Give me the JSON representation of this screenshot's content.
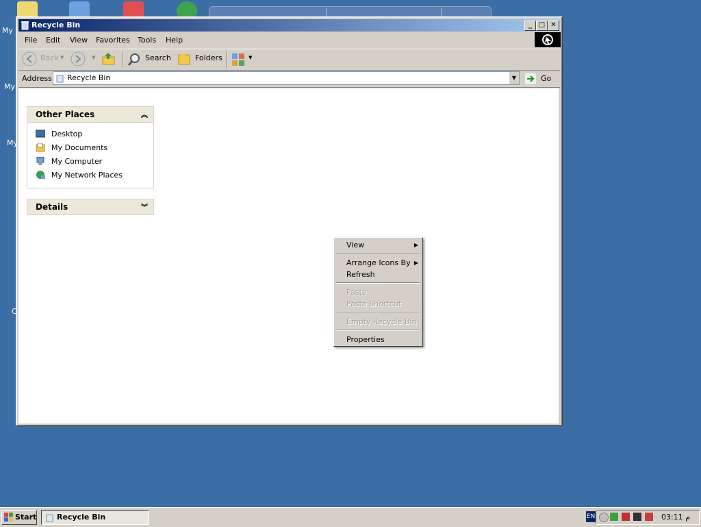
{
  "desktop": {
    "labels": [
      "My D",
      "My",
      "My",
      "C"
    ]
  },
  "window": {
    "title": "Recycle Bin",
    "minimize": "_",
    "maximize": "□",
    "close": "✕"
  },
  "menubar": [
    "File",
    "Edit",
    "View",
    "Favorites",
    "Tools",
    "Help"
  ],
  "toolbar": {
    "back": "Back",
    "search": "Search",
    "folders": "Folders"
  },
  "address": {
    "label": "Address",
    "value": "Recycle Bin",
    "go": "Go"
  },
  "other_places": {
    "title": "Other Places",
    "items": [
      "Desktop",
      "My Documents",
      "My Computer",
      "My Network Places"
    ]
  },
  "details": {
    "title": "Details"
  },
  "context_menu": {
    "view": "View",
    "arrange": "Arrange Icons By",
    "refresh": "Refresh",
    "paste": "Paste",
    "paste_shortcut": "Paste Shortcut",
    "empty": "Empty Recycle Bin",
    "properties": "Properties"
  },
  "taskbar": {
    "start": "Start",
    "task": "Recycle Bin",
    "lang": "EN",
    "time": "03:11 م"
  },
  "colors": {
    "desktop": "#3a6ea5",
    "titlebar_start": "#0a246a",
    "titlebar_end": "#a6caf0"
  }
}
